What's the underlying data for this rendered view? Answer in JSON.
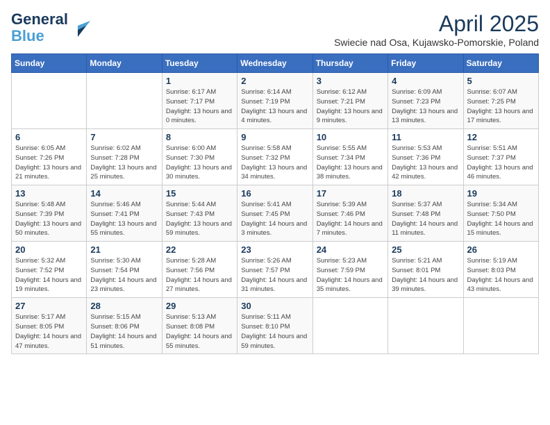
{
  "header": {
    "logo_line1": "General",
    "logo_line2": "Blue",
    "month_title": "April 2025",
    "location": "Swiecie nad Osa, Kujawsko-Pomorskie, Poland"
  },
  "days_of_week": [
    "Sunday",
    "Monday",
    "Tuesday",
    "Wednesday",
    "Thursday",
    "Friday",
    "Saturday"
  ],
  "weeks": [
    [
      {
        "day": "",
        "info": ""
      },
      {
        "day": "",
        "info": ""
      },
      {
        "day": "1",
        "info": "Sunrise: 6:17 AM\nSunset: 7:17 PM\nDaylight: 13 hours and 0 minutes."
      },
      {
        "day": "2",
        "info": "Sunrise: 6:14 AM\nSunset: 7:19 PM\nDaylight: 13 hours and 4 minutes."
      },
      {
        "day": "3",
        "info": "Sunrise: 6:12 AM\nSunset: 7:21 PM\nDaylight: 13 hours and 9 minutes."
      },
      {
        "day": "4",
        "info": "Sunrise: 6:09 AM\nSunset: 7:23 PM\nDaylight: 13 hours and 13 minutes."
      },
      {
        "day": "5",
        "info": "Sunrise: 6:07 AM\nSunset: 7:25 PM\nDaylight: 13 hours and 17 minutes."
      }
    ],
    [
      {
        "day": "6",
        "info": "Sunrise: 6:05 AM\nSunset: 7:26 PM\nDaylight: 13 hours and 21 minutes."
      },
      {
        "day": "7",
        "info": "Sunrise: 6:02 AM\nSunset: 7:28 PM\nDaylight: 13 hours and 25 minutes."
      },
      {
        "day": "8",
        "info": "Sunrise: 6:00 AM\nSunset: 7:30 PM\nDaylight: 13 hours and 30 minutes."
      },
      {
        "day": "9",
        "info": "Sunrise: 5:58 AM\nSunset: 7:32 PM\nDaylight: 13 hours and 34 minutes."
      },
      {
        "day": "10",
        "info": "Sunrise: 5:55 AM\nSunset: 7:34 PM\nDaylight: 13 hours and 38 minutes."
      },
      {
        "day": "11",
        "info": "Sunrise: 5:53 AM\nSunset: 7:36 PM\nDaylight: 13 hours and 42 minutes."
      },
      {
        "day": "12",
        "info": "Sunrise: 5:51 AM\nSunset: 7:37 PM\nDaylight: 13 hours and 46 minutes."
      }
    ],
    [
      {
        "day": "13",
        "info": "Sunrise: 5:48 AM\nSunset: 7:39 PM\nDaylight: 13 hours and 50 minutes."
      },
      {
        "day": "14",
        "info": "Sunrise: 5:46 AM\nSunset: 7:41 PM\nDaylight: 13 hours and 55 minutes."
      },
      {
        "day": "15",
        "info": "Sunrise: 5:44 AM\nSunset: 7:43 PM\nDaylight: 13 hours and 59 minutes."
      },
      {
        "day": "16",
        "info": "Sunrise: 5:41 AM\nSunset: 7:45 PM\nDaylight: 14 hours and 3 minutes."
      },
      {
        "day": "17",
        "info": "Sunrise: 5:39 AM\nSunset: 7:46 PM\nDaylight: 14 hours and 7 minutes."
      },
      {
        "day": "18",
        "info": "Sunrise: 5:37 AM\nSunset: 7:48 PM\nDaylight: 14 hours and 11 minutes."
      },
      {
        "day": "19",
        "info": "Sunrise: 5:34 AM\nSunset: 7:50 PM\nDaylight: 14 hours and 15 minutes."
      }
    ],
    [
      {
        "day": "20",
        "info": "Sunrise: 5:32 AM\nSunset: 7:52 PM\nDaylight: 14 hours and 19 minutes."
      },
      {
        "day": "21",
        "info": "Sunrise: 5:30 AM\nSunset: 7:54 PM\nDaylight: 14 hours and 23 minutes."
      },
      {
        "day": "22",
        "info": "Sunrise: 5:28 AM\nSunset: 7:56 PM\nDaylight: 14 hours and 27 minutes."
      },
      {
        "day": "23",
        "info": "Sunrise: 5:26 AM\nSunset: 7:57 PM\nDaylight: 14 hours and 31 minutes."
      },
      {
        "day": "24",
        "info": "Sunrise: 5:23 AM\nSunset: 7:59 PM\nDaylight: 14 hours and 35 minutes."
      },
      {
        "day": "25",
        "info": "Sunrise: 5:21 AM\nSunset: 8:01 PM\nDaylight: 14 hours and 39 minutes."
      },
      {
        "day": "26",
        "info": "Sunrise: 5:19 AM\nSunset: 8:03 PM\nDaylight: 14 hours and 43 minutes."
      }
    ],
    [
      {
        "day": "27",
        "info": "Sunrise: 5:17 AM\nSunset: 8:05 PM\nDaylight: 14 hours and 47 minutes."
      },
      {
        "day": "28",
        "info": "Sunrise: 5:15 AM\nSunset: 8:06 PM\nDaylight: 14 hours and 51 minutes."
      },
      {
        "day": "29",
        "info": "Sunrise: 5:13 AM\nSunset: 8:08 PM\nDaylight: 14 hours and 55 minutes."
      },
      {
        "day": "30",
        "info": "Sunrise: 5:11 AM\nSunset: 8:10 PM\nDaylight: 14 hours and 59 minutes."
      },
      {
        "day": "",
        "info": ""
      },
      {
        "day": "",
        "info": ""
      },
      {
        "day": "",
        "info": ""
      }
    ]
  ]
}
